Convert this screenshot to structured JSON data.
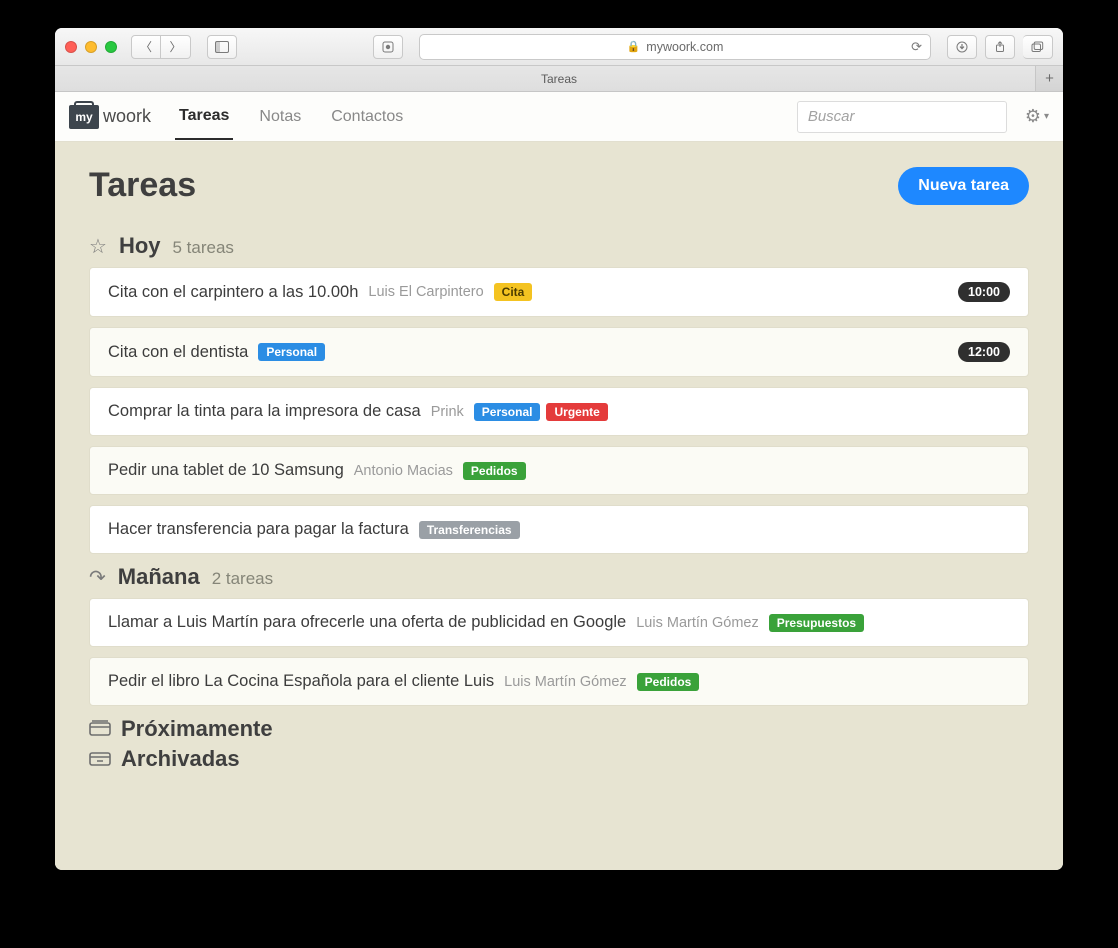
{
  "browser": {
    "url_host": "mywoork.com",
    "tab_title": "Tareas"
  },
  "app": {
    "logo_badge": "my",
    "logo_text": "woork",
    "nav": {
      "tareas": "Tareas",
      "notas": "Notas",
      "contactos": "Contactos"
    },
    "search_placeholder": "Buscar"
  },
  "page": {
    "title": "Tareas",
    "new_task": "Nueva tarea",
    "sections": {
      "today": {
        "title": "Hoy",
        "subtitle": "5 tareas"
      },
      "tomorrow": {
        "title": "Mañana",
        "subtitle": "2 tareas"
      },
      "upcoming": "Próximamente",
      "archived": "Archivadas"
    }
  },
  "tasks_today": [
    {
      "title": "Cita con el carpintero a las 10.00h",
      "sub": "Luis El Carpintero",
      "tags": [
        {
          "text": "Cita",
          "color": "yellow"
        }
      ],
      "time": "10:00"
    },
    {
      "title": "Cita con el dentista",
      "sub": "",
      "tags": [
        {
          "text": "Personal",
          "color": "blue"
        }
      ],
      "time": "12:00"
    },
    {
      "title": "Comprar la tinta para la impresora de casa",
      "sub": "Prink",
      "tags": [
        {
          "text": "Personal",
          "color": "blue"
        },
        {
          "text": "Urgente",
          "color": "red"
        }
      ],
      "time": ""
    },
    {
      "title": "Pedir una tablet de 10 Samsung",
      "sub": "Antonio Macias",
      "tags": [
        {
          "text": "Pedidos",
          "color": "green"
        }
      ],
      "time": ""
    },
    {
      "title": "Hacer transferencia para pagar la factura",
      "sub": "",
      "tags": [
        {
          "text": "Transferencias",
          "color": "gray"
        }
      ],
      "time": ""
    }
  ],
  "tasks_tomorrow": [
    {
      "title": "Llamar a Luis Martín para ofrecerle una oferta de publicidad en Google",
      "sub": "Luis Martín Gómez",
      "tags": [
        {
          "text": "Presupuestos",
          "color": "green"
        }
      ],
      "time": ""
    },
    {
      "title": "Pedir el libro La Cocina Española para el cliente Luis",
      "sub": "Luis Martín Gómez",
      "tags": [
        {
          "text": "Pedidos",
          "color": "green"
        }
      ],
      "time": ""
    }
  ]
}
